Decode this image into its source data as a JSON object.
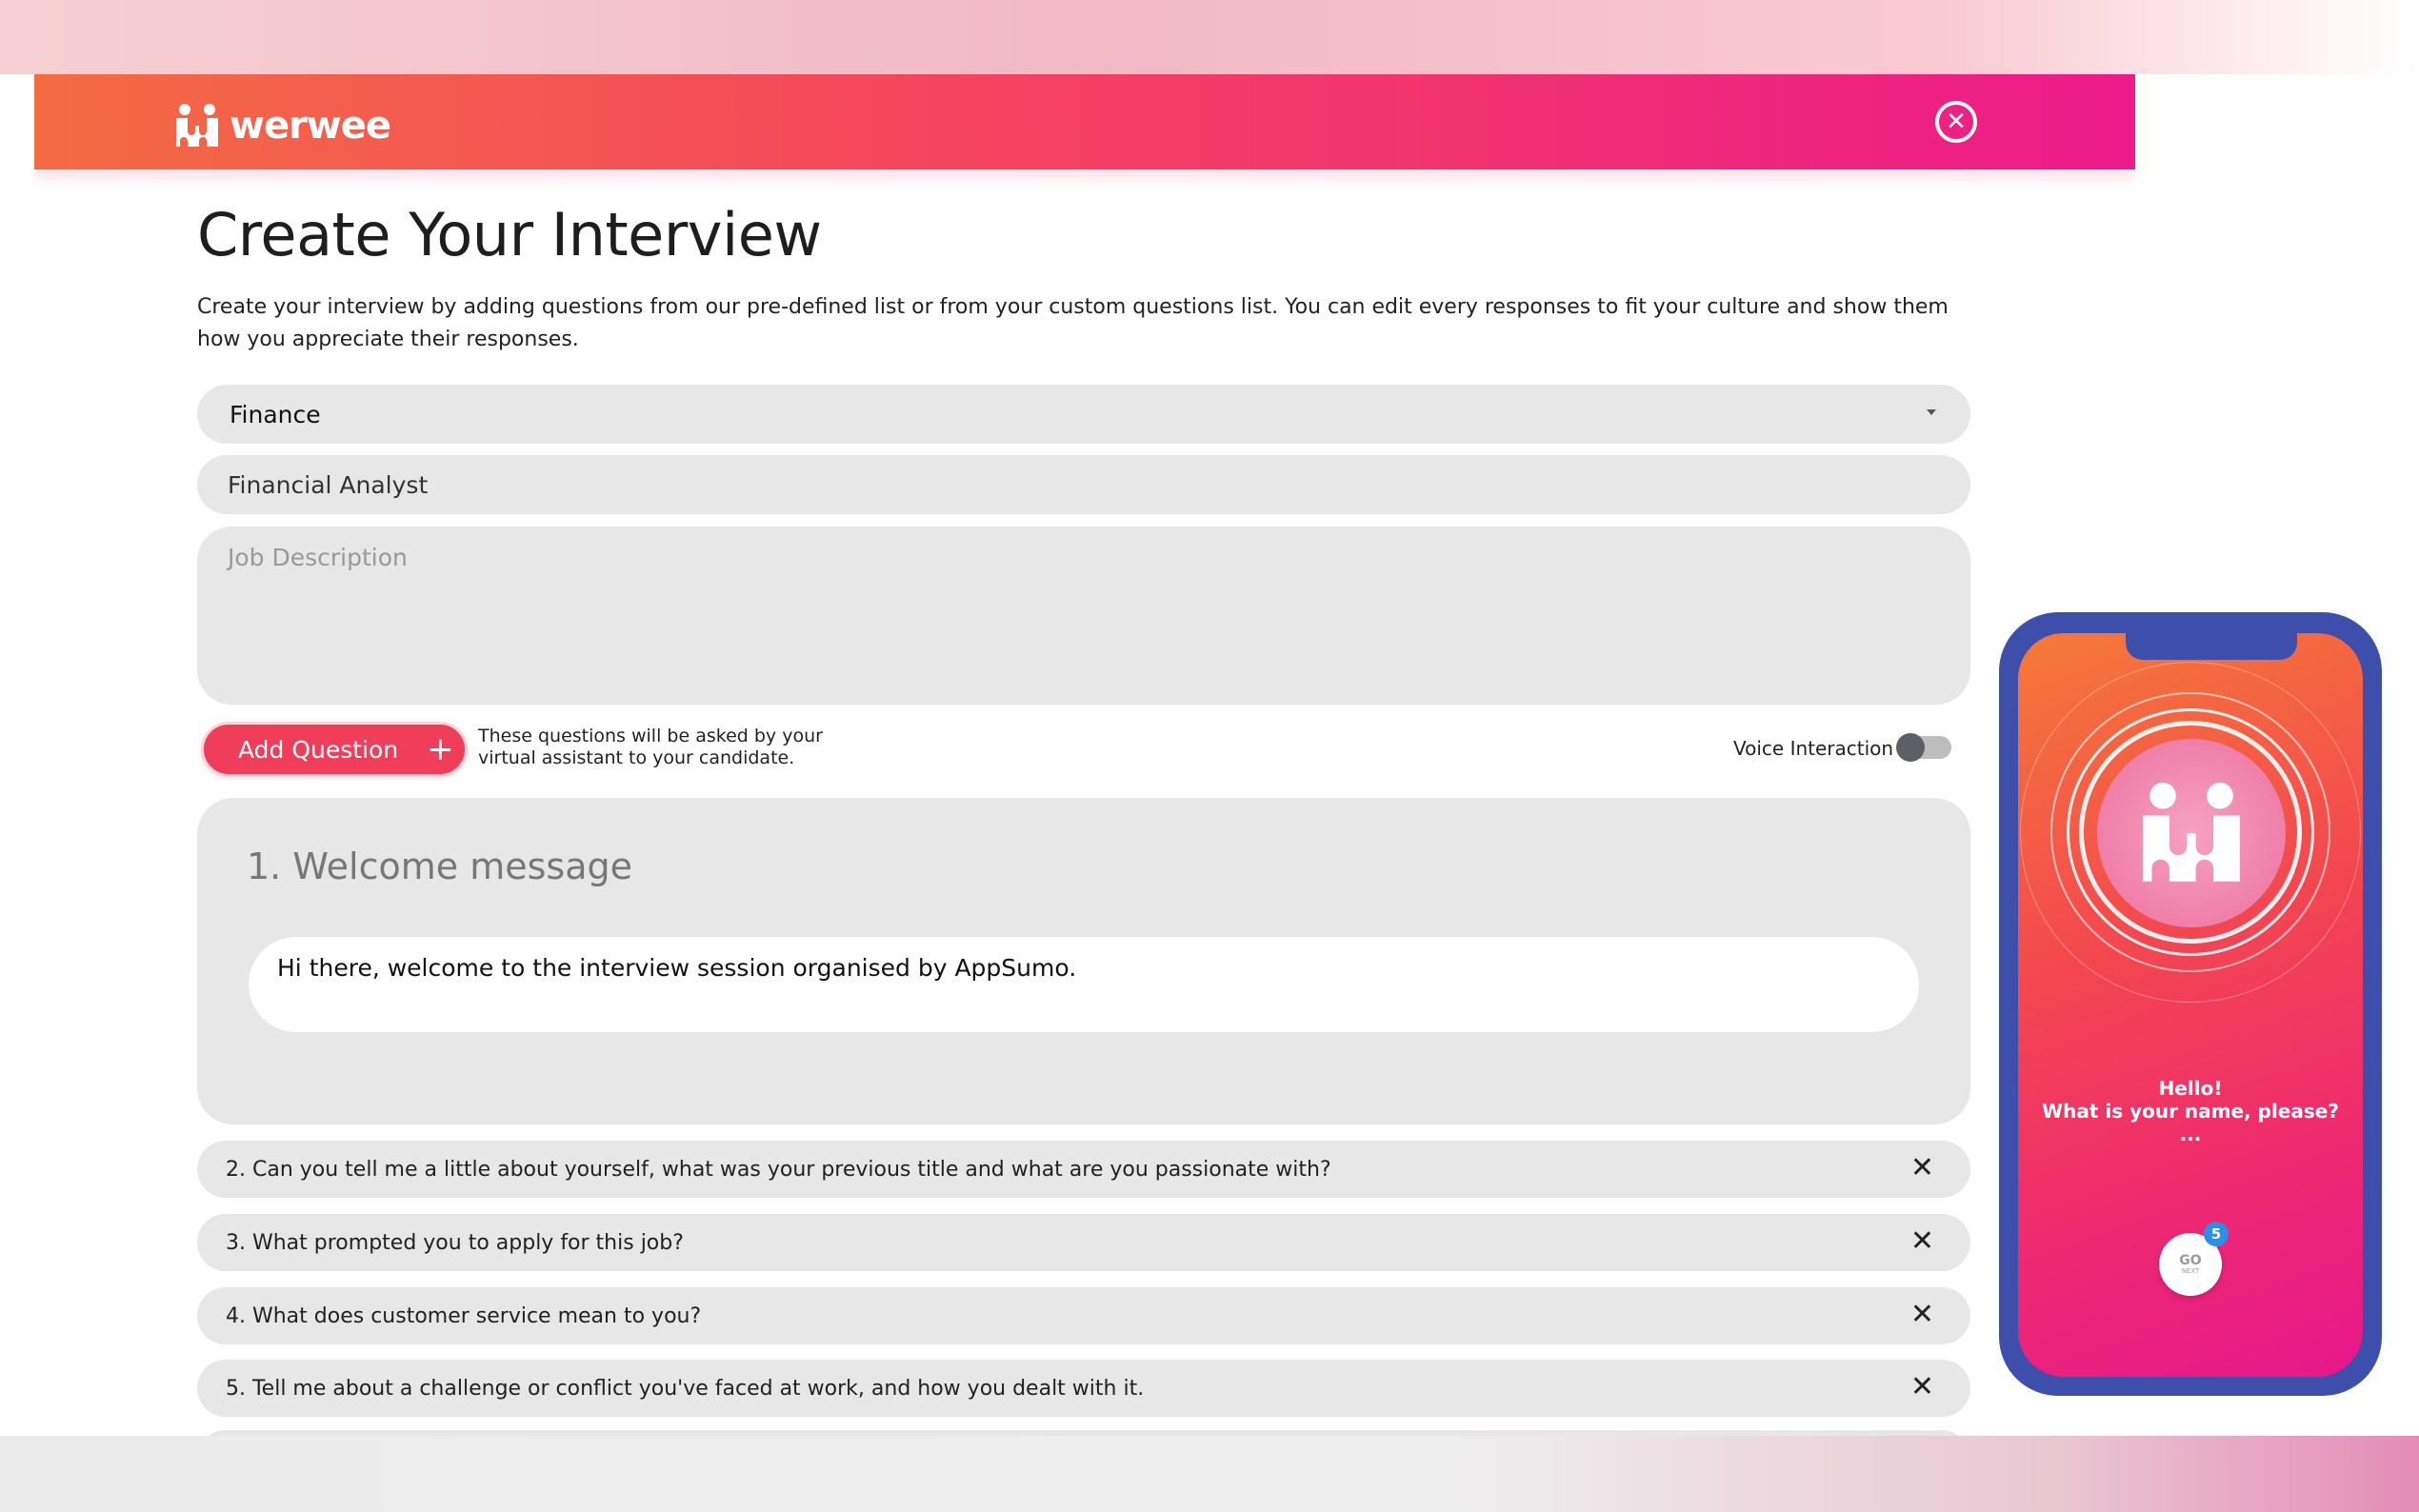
{
  "app": {
    "brand": "werwee"
  },
  "page": {
    "title": "Create Your Interview",
    "intro": "Create your interview by adding questions from our pre-defined list or from your custom questions list. You can edit every responses to fit your culture and show them how you appreciate their responses."
  },
  "form": {
    "category_value": "Finance",
    "job_title_value": "Financial Analyst",
    "job_description_placeholder": "Job Description"
  },
  "actions": {
    "add_question_label": "Add Question",
    "add_question_icon": "+",
    "hint": "These questions will be asked by your virtual assistant to your candidate.",
    "voice_interaction_label": "Voice Interaction",
    "voice_interaction_on": false
  },
  "questions": [
    {
      "label": "1. Welcome message",
      "answer": "Hi there, welcome to the interview session organised by AppSumo."
    },
    {
      "label": "2. Can you tell me a little about yourself, what was your previous title and what are you passionate with?"
    },
    {
      "label": "3. What prompted you to apply for this job?"
    },
    {
      "label": "4. What does customer service mean to you?"
    },
    {
      "label": "5. Tell me about a challenge or conflict you've faced at work, and how you dealt with it."
    }
  ],
  "close_icon": "close-circle-icon",
  "remove_icon": "x-icon",
  "preview": {
    "greeting": "Hello!",
    "question": "What is your name, please?",
    "typing": "...",
    "go_label": "GO",
    "next_label": "NEXT",
    "badge_count": "5"
  },
  "colors": {
    "header_start": "#f36b43",
    "header_end": "#ec1a8a",
    "accent": "#ef3d5a",
    "phone_frame": "#3e4fab",
    "badge": "#2d8ee8"
  }
}
